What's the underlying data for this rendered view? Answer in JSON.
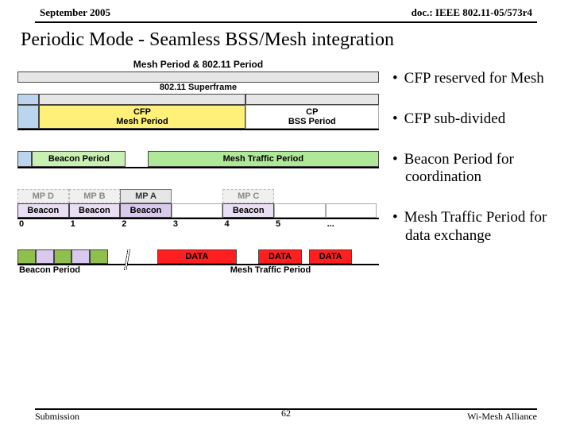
{
  "header": {
    "date": "September 2005",
    "docnum": "doc.: IEEE 802.11-05/573r4"
  },
  "title": "Periodic Mode - Seamless BSS/Mesh integration",
  "diag1": {
    "caption": "Mesh Period & 802.11 Period",
    "sub": "802.11 Superframe",
    "cfp_label": "CFP",
    "cfp_sub": "Mesh Period",
    "cp_label": "CP",
    "cp_sub": "BSS Period"
  },
  "diag2": {
    "left": "Beacon Period",
    "right": "Mesh Traffic Period"
  },
  "diag3": {
    "mps": [
      "MP D",
      "MP B",
      "MP A",
      "",
      "MP C",
      "",
      ""
    ],
    "beacons": [
      "Beacon",
      "Beacon",
      "Beacon",
      "",
      "Beacon",
      "",
      ""
    ],
    "ticks": [
      "0",
      "1",
      "2",
      "3",
      "4",
      "5",
      "..."
    ]
  },
  "diag4": {
    "bp_label": "Beacon Period",
    "mtp_label": "Mesh Traffic Period",
    "data_label": "DATA"
  },
  "bullets": [
    "CFP reserved for Mesh",
    "CFP sub-divided",
    "Beacon Period for coordination",
    "Mesh Traffic Period for data exchange"
  ],
  "footer": {
    "left": "Submission",
    "right": "Wi-Mesh Alliance",
    "page": "62"
  }
}
